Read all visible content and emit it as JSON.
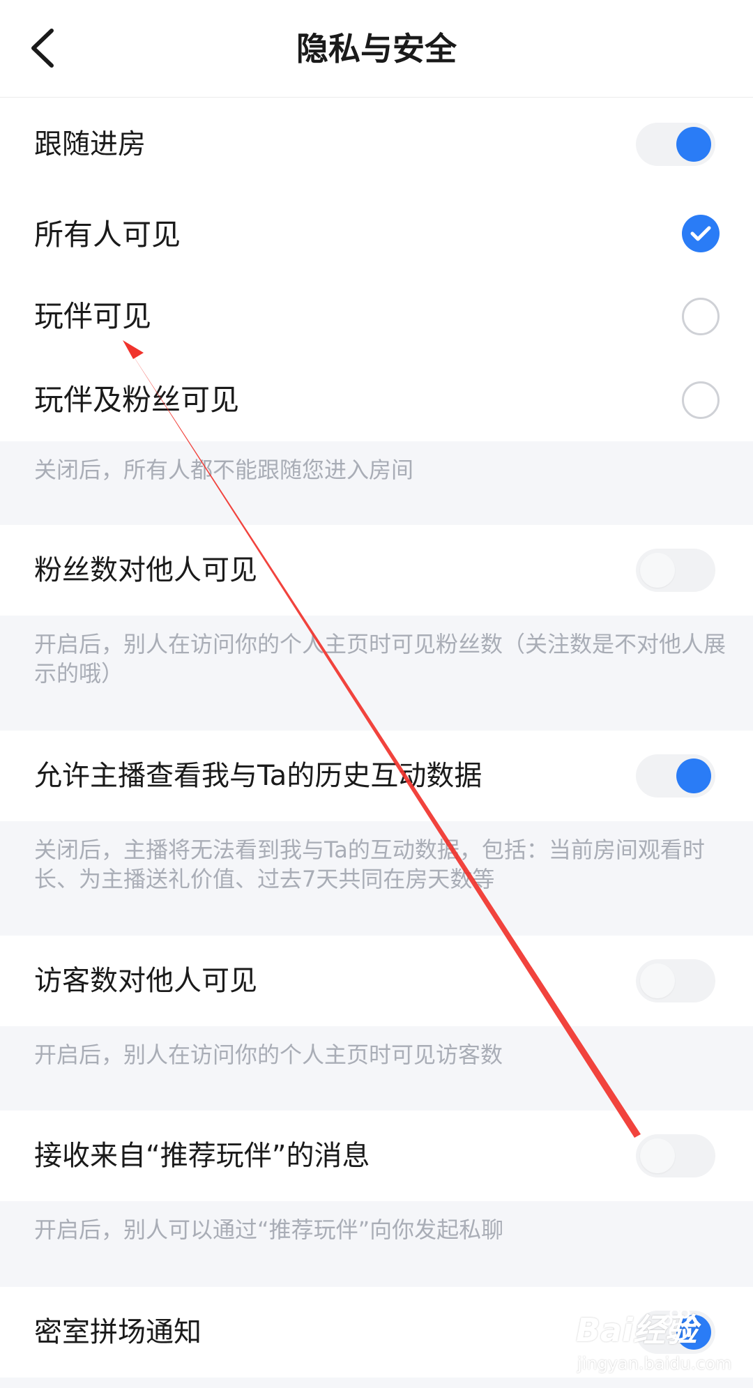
{
  "header": {
    "title": "隐私与安全",
    "back_icon": "chevron-left-icon"
  },
  "colors": {
    "accent": "#2a7cf6",
    "note_background": "#f5f6f9",
    "note_text": "#a9adb6",
    "annotation_arrow": "#f0332c"
  },
  "settings": {
    "follow_room": {
      "label": "跟随进房",
      "enabled": true
    },
    "visibility": {
      "selected": "所有人可见",
      "options": [
        {
          "label": "所有人可见",
          "checked": true
        },
        {
          "label": "玩伴可见",
          "checked": false
        },
        {
          "label": "玩伴及粉丝可见",
          "checked": false
        }
      ],
      "note": "关闭后，所有人都不能跟随您进入房间"
    },
    "fans_count": {
      "label": "粉丝数对他人可见",
      "enabled": false,
      "note": "开启后，别人在访问你的个人主页时可见粉丝数（关注数是不对他人展示的哦）"
    },
    "history_interaction": {
      "label": "允许主播查看我与Ta的历史互动数据",
      "enabled": true,
      "note": "关闭后，主播将无法看到我与Ta的互动数据，包括：当前房间观看时长、为主播送礼价值、过去7天共同在房天数等"
    },
    "visitor_count": {
      "label": "访客数对他人可见",
      "enabled": false,
      "note": "开启后，别人在访问你的个人主页时可见访客数"
    },
    "recommend_messages": {
      "label": "接收来自“推荐玩伴”的消息",
      "enabled": false,
      "note": "开启后，别人可以通过“推荐玩伴”向你发起私聊"
    },
    "escape_room": {
      "label": "密室拼场通知",
      "enabled": true
    }
  },
  "watermark": {
    "logo_text": "Bai经验",
    "url_text": "jingyan.baidu.com"
  }
}
